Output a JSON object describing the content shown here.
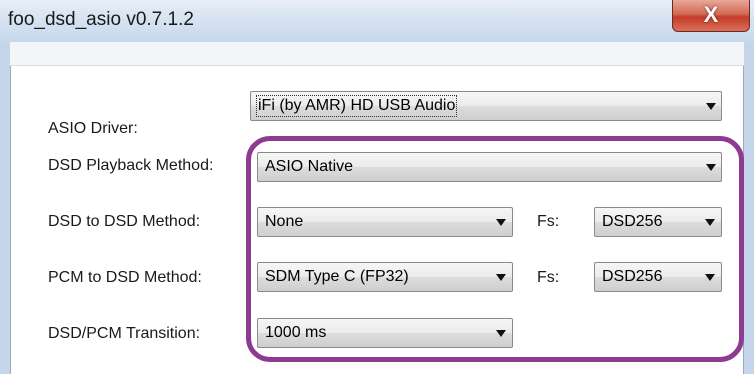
{
  "window": {
    "title": "foo_dsd_asio v0.7.1.2",
    "close_label": "X"
  },
  "form": {
    "rows": [
      {
        "label": "ASIO Driver:",
        "value": "iFi (by AMR) HD USB Audio"
      },
      {
        "label": "DSD Playback Method:",
        "value": "ASIO Native"
      },
      {
        "label": "DSD to DSD Method:",
        "value": "None",
        "fs_label": "Fs:",
        "fs_value": "DSD256"
      },
      {
        "label": "PCM to DSD Method:",
        "value": "SDM Type C (FP32)",
        "fs_label": "Fs:",
        "fs_value": "DSD256"
      },
      {
        "label": "DSD/PCM Transition:",
        "value": "1000 ms"
      }
    ]
  },
  "colors": {
    "highlight": "#8e3a91",
    "title_bar": "#d4e1f1",
    "close_button": "#c43c28"
  }
}
